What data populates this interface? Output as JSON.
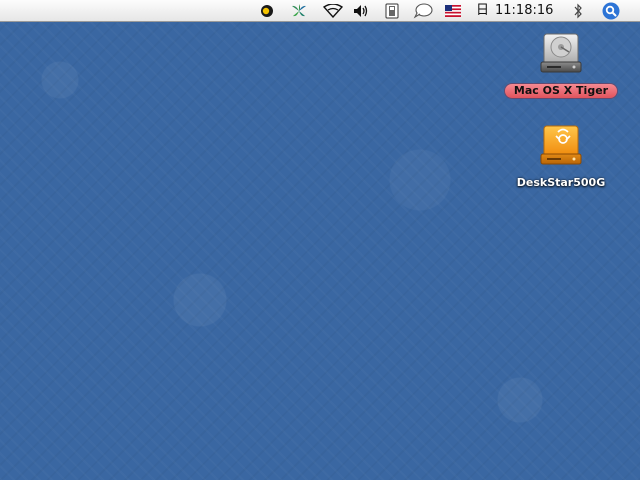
{
  "menubar": {
    "clock": "11:18:16",
    "calendar_glyph": "日",
    "icons": [
      {
        "name": "display-status-icon"
      },
      {
        "name": "app-leaf-icon"
      },
      {
        "name": "wifi-icon"
      },
      {
        "name": "volume-icon"
      },
      {
        "name": "clipboard-icon"
      },
      {
        "name": "chat-bubble-icon"
      },
      {
        "name": "us-flag-input-icon"
      },
      {
        "name": "bluetooth-icon"
      },
      {
        "name": "spotlight-icon"
      }
    ]
  },
  "desktop": {
    "icons": [
      {
        "name": "mac-os-x-tiger-drive",
        "label": "Mac OS X Tiger",
        "kind": "internal-hard-drive",
        "selected": true
      },
      {
        "name": "deskstar500g-drive",
        "label": "DeskStar500G",
        "kind": "firewire-drive",
        "selected": false
      }
    ]
  },
  "colors": {
    "desktop_blue": "#3a67a2",
    "selection_label": "#e0535d",
    "drive_orange": "#f29a1e",
    "spotlight_blue": "#2d74d6"
  }
}
